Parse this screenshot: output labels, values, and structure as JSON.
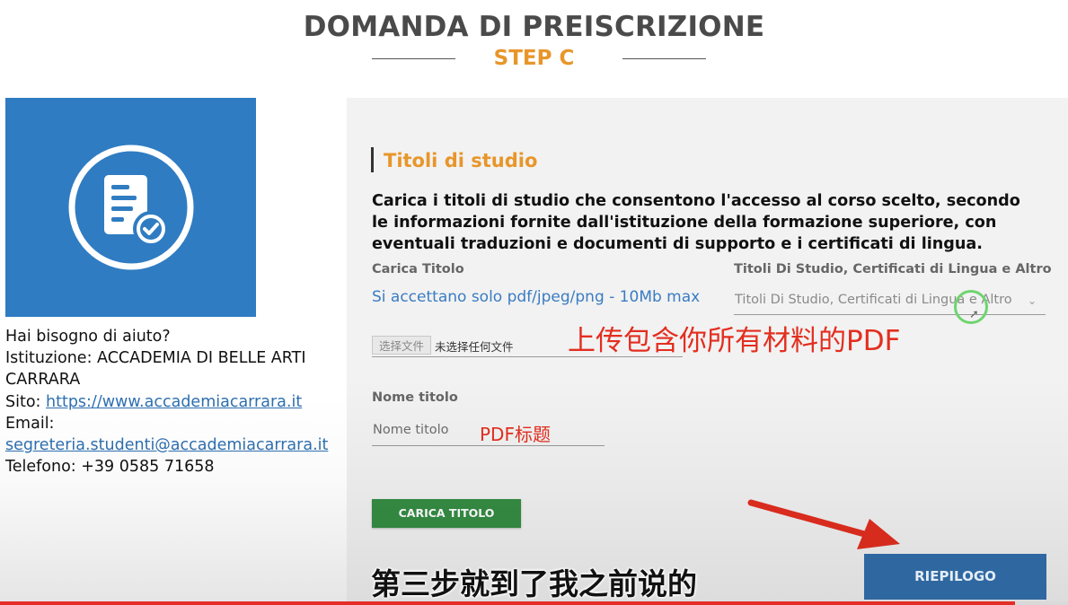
{
  "header": {
    "title": "DOMANDA DI PREISCRIZIONE",
    "step": "STEP C"
  },
  "help": {
    "question": "Hai bisogno di aiuto?",
    "institution_line": "Istituzione: ACCADEMIA DI BELLE ARTI CARRARA",
    "site_label": "Sito: ",
    "site_url": "https://www.accademiacarrara.it",
    "email_label": "Email:",
    "email": "segreteria.studenti@accademiacarrara.it",
    "phone_line": "Telefono: +39 0585 71658"
  },
  "form": {
    "section_title": "Titoli di studio",
    "intro": "Carica i titoli di studio che consentono l'accesso al corso scelto, secondo le informazioni fornite dall'istituzione della formazione superiore, con eventuali traduzioni e documenti di supporto e i certificati di lingua.",
    "upload_label": "Carica Titolo",
    "upload_hint": "Si accettano solo pdf/jpeg/png - 10Mb max",
    "file_button": "选择文件",
    "file_status": "未选择任何文件",
    "type_label": "Titoli Di Studio, Certificati di Lingua e Altro",
    "type_value": "Titoli Di Studio, Certificati di Lingua e Altro",
    "name_label": "Nome titolo",
    "name_placeholder": "Nome titolo",
    "upload_button": "CARICA TITOLO",
    "summary_button": "RIEPILOGO"
  },
  "annotations": {
    "upload_note": "上传包含你所有材料的PDF",
    "title_note": "PDF标题"
  },
  "video": {
    "subtitle": "第三步就到了我之前说的",
    "progress": 0.95
  },
  "colors": {
    "accent_orange": "#e8962a",
    "logo_blue": "#2f7cc2",
    "green_button": "#358d43",
    "blue_button": "#2f68a0",
    "annotation_red": "#e32e1f",
    "hint_blue": "#3a7cc2"
  },
  "icons": {
    "logo": "document-check-icon",
    "select_chevron": "chevron-down-icon",
    "annotation_arrow": "red-arrow-icon"
  }
}
